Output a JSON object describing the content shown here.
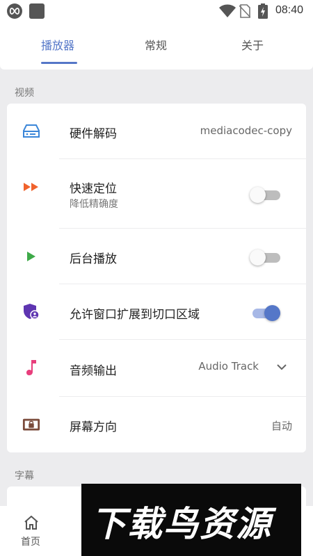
{
  "status_bar": {
    "time": "08:40",
    "icons": [
      "infinity-icon",
      "square-icon",
      "wifi-icon",
      "no-sim-icon",
      "battery-charging-icon"
    ]
  },
  "tabs": [
    {
      "label": "播放器",
      "active": true
    },
    {
      "label": "常规",
      "active": false
    },
    {
      "label": "关于",
      "active": false
    }
  ],
  "video_section": {
    "label": "视频",
    "rows": [
      {
        "title": "硬件解码",
        "value": "mediacodec-copy",
        "icon": "hardware-decode-icon",
        "icon_color": "#3b86d8"
      },
      {
        "title": "快速定位",
        "subtitle": "降低精确度",
        "toggle_on": false,
        "icon": "fast-forward-icon",
        "icon_color": "#f0622c"
      },
      {
        "title": "后台播放",
        "toggle_on": false,
        "icon": "play-icon",
        "icon_color": "#3eaa49"
      },
      {
        "title": "允许窗口扩展到切口区域",
        "toggle_on": true,
        "icon": "shield-user-icon",
        "icon_color": "#5e35b1"
      },
      {
        "title": "音频输出",
        "value": "Audio Track",
        "icon": "music-note-icon",
        "icon_color": "#e83e7c"
      },
      {
        "title": "屏幕方向",
        "value": "自动",
        "icon": "screen-lock-icon",
        "icon_color": "#7a4a3a"
      }
    ]
  },
  "subtitle_section": {
    "label": "字幕"
  },
  "bottom_nav": {
    "home_label": "首页"
  },
  "watermark": {
    "text": "下载鸟资源"
  },
  "colors": {
    "accent": "#5577c8",
    "background": "#ececee",
    "card": "#ffffff"
  }
}
